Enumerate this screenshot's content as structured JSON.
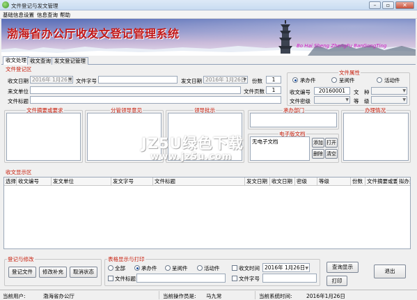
{
  "window": {
    "title": "文件登记与发文管理",
    "min_label": "–",
    "max_label": "▫",
    "close_label": "✕"
  },
  "menu": {
    "items": [
      "基础信息设置",
      "信息查询",
      "帮助"
    ]
  },
  "banner": {
    "title": "渤海省办公厅收发文登记管理系统",
    "subtitle": "Bo Hai Sheng ZhengFu BanGongTing"
  },
  "tabs": [
    "收文处理",
    "收文查询",
    "发文登记管理"
  ],
  "register": {
    "section_title": "文件登记区",
    "receive_date_label": "收文日期",
    "receive_date_value": "2016年 1月26日",
    "doc_number_label": "文件字号",
    "doc_number_value": "",
    "send_date_label": "发文日期",
    "send_date_value": "2016年 1月26日",
    "copies_label": "份数",
    "copies_value": "1",
    "from_unit_label": "来文单位",
    "from_unit_value": "",
    "pages_label": "文件页数",
    "pages_value": "1",
    "doc_title_label": "文件标题",
    "doc_title_value": ""
  },
  "attributes": {
    "title": "文件属性",
    "radios": [
      {
        "label": "承办件",
        "checked": true
      },
      {
        "label": "呈阅件",
        "checked": false
      },
      {
        "label": "活动件",
        "checked": false
      }
    ],
    "receive_no_label": "收文编号",
    "receive_no_value": "20160001",
    "type_label": "文　种",
    "type_value": "",
    "secret_label": "文件密级",
    "secret_value": "",
    "level_label": "等　级",
    "level_value": ""
  },
  "groups": {
    "summary": "文件摘要或要求",
    "leader": "分管领导意见",
    "approval": "领导批示",
    "dept": "承办部门",
    "progress": "办理情况",
    "edoc": "电子版文档"
  },
  "edoc": {
    "status": "无电子文档",
    "add": "添加",
    "open": "打开",
    "delete": "删除",
    "clear": "清空"
  },
  "grid": {
    "section_title": "收文显示区",
    "columns": [
      "选择",
      "收文编号",
      "发文单位",
      "发文字号",
      "文件标题",
      "发文日期",
      "收文日期",
      "密级",
      "等级",
      "份数",
      "文件摘要或要",
      "拟办意"
    ]
  },
  "edit": {
    "title": "登记与修改",
    "register": "登记文件",
    "modify": "修改补充",
    "cancel": "取消状态"
  },
  "filter": {
    "title": "表格显示与打印",
    "radios": [
      {
        "label": "全部",
        "checked": false
      },
      {
        "label": "承办件",
        "checked": true
      },
      {
        "label": "呈阅件",
        "checked": false
      },
      {
        "label": "活动件",
        "checked": false
      }
    ],
    "time_check": "收文时间",
    "time_value": "2016年 1月26日",
    "title_check": "文件标题",
    "title_value": "",
    "number_check": "文件字号",
    "number_value": ""
  },
  "actions": {
    "query": "查询显示",
    "print": "打印",
    "exit": "退出"
  },
  "status": {
    "user_label": "当前用户:",
    "user_value": "渤海省办公厅",
    "operator_label": "当前操作员是:",
    "operator_value": "马九常",
    "systime_label": "当前系统时间:",
    "systime_value": "2016年1月26日"
  },
  "watermark": {
    "line1": "JZ5U绿色下载",
    "line2": "www.jz5u.com"
  },
  "colors": {
    "section_red": "#c8200e",
    "banner_title": "#c21818",
    "banner_sub": "#d01bc4"
  }
}
